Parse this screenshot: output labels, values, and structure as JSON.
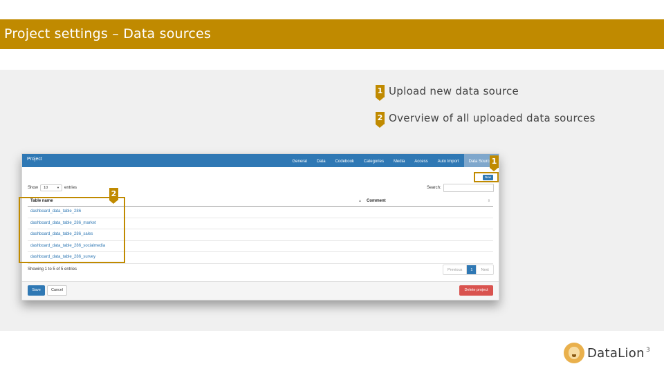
{
  "slide": {
    "title": "Project settings – Data sources",
    "page_number": "3",
    "brand": "DataLion",
    "accent_color": "#c08a00"
  },
  "callouts": [
    {
      "number": "1",
      "text": "Upload new data source"
    },
    {
      "number": "2",
      "text": "Overview of all uploaded data sources"
    }
  ],
  "app": {
    "brand": "Project",
    "tabs": [
      "General",
      "Data",
      "Codebook",
      "Categories",
      "Media",
      "Access",
      "Auto Import",
      "Data Sources"
    ],
    "active_tab": "Data Sources",
    "new_button": "New",
    "show_label": "Show",
    "entries_value": "10",
    "entries_label": "entries",
    "search_label": "Search:",
    "search_value": "",
    "columns": [
      "Table name",
      "Comment"
    ],
    "rows": [
      "dashboard_data_table_286",
      "dashboard_data_table_286_market",
      "dashboard_data_table_286_sales",
      "dashboard_data_table_286_socialmedia",
      "dashboard_data_table_286_survey"
    ],
    "showing_text": "Showing 1 to 5 of 5 entries",
    "pager": {
      "previous": "Previous",
      "current": "1",
      "next": "Next"
    },
    "save_label": "Save",
    "cancel_label": "Cancel",
    "delete_label": "Delete project"
  }
}
